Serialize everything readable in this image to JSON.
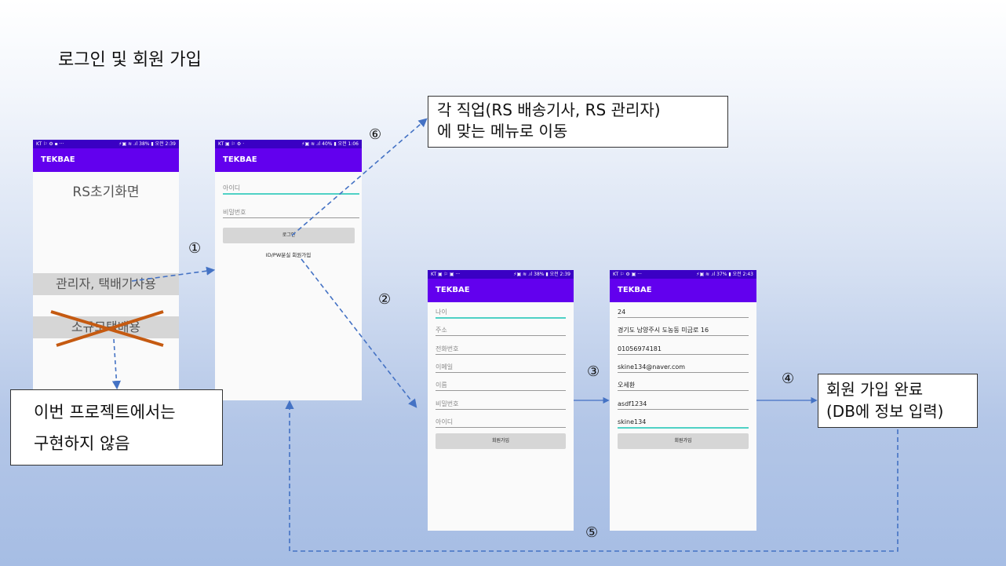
{
  "page_title": "로그인 및 회원 가입",
  "phone1": {
    "status_left": "KT ⚐ ⚙ ▪ ···",
    "status_right": "⚡▣ ≋ .ıl 38% ▮ 오전 2:39",
    "app_name": "TEKBAE",
    "heading": "RS초기화면",
    "btn_admin": "관리자, 택배기사용",
    "btn_small": "소규모택배용"
  },
  "phone2": {
    "status_left": "KT ▣ ⚐ ⚙ ·",
    "status_right": "⚡▣ ≋ .ıl 40% ▮ 오전 1:06",
    "app_name": "TEKBAE",
    "id_placeholder": "아이디",
    "pw_placeholder": "비밀번호",
    "login_label": "로그인",
    "links": "ID/PW분실 회원가입"
  },
  "phone3": {
    "status_left": "KT ▣ ⚐ ▣ ···",
    "status_right": "⚡▣ ≋ .ıl 38% ▮ 오전 2:39",
    "app_name": "TEKBAE",
    "fields": [
      "나이",
      "주소",
      "전화번호",
      "이메일",
      "이름",
      "비밀번호",
      "아이디"
    ],
    "button": "회원가입"
  },
  "phone4": {
    "status_left": "KT ⚐ ⚙ ▣ ···",
    "status_right": "⚡▣ ≋ .ıl 37% ▮ 오전 2:43",
    "app_name": "TEKBAE",
    "values": [
      "24",
      "경기도 남양주시 도농동 미금로 16",
      "01056974181",
      "skine134@naver.com",
      "오세환",
      "asdf1234",
      "skine134"
    ],
    "button": "회원가입"
  },
  "callouts": {
    "menu_line1": "각 직업(RS 배송기사, RS 관리자)",
    "menu_line2": "에 맞는 메뉴로 이동",
    "notimpl_line1": "이번 프로젝트에서는",
    "notimpl_line2": "구현하지 않음",
    "done_line1": "회원 가입 완료",
    "done_line2": "(DB에 정보 입력)"
  },
  "step_numbers": [
    "①",
    "②",
    "③",
    "④",
    "⑤",
    "⑥"
  ],
  "colors": {
    "arrow": "#4472c4",
    "cross": "#c55a11",
    "appbar": "#6200ee",
    "statusbar": "#3a00c4",
    "focus": "#4fd1c5"
  }
}
